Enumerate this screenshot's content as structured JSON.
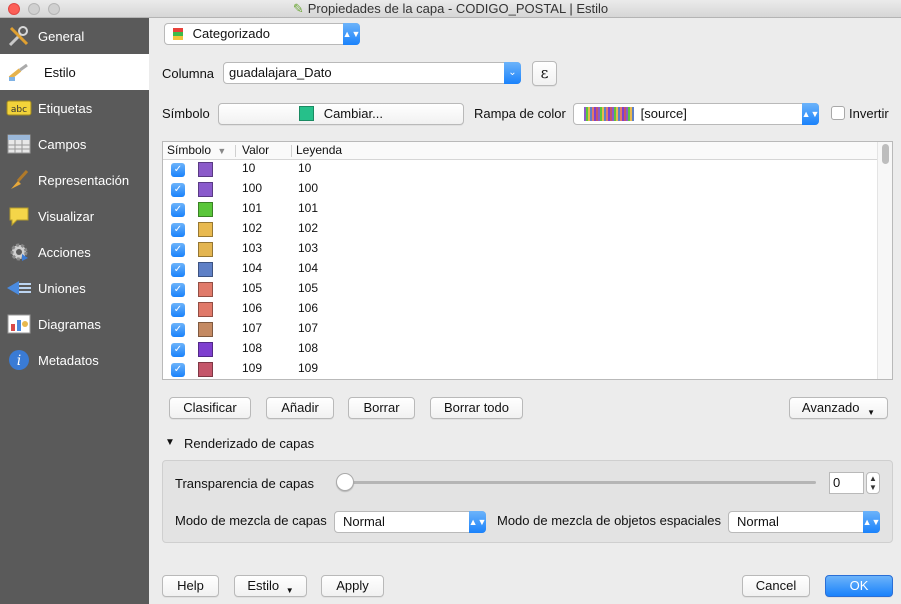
{
  "window": {
    "title": "Propiedades de la capa - CODIGO_POSTAL | Estilo"
  },
  "sidebar": {
    "items": [
      {
        "label": "General",
        "icon": "tools-icon",
        "active": false
      },
      {
        "label": "Estilo",
        "icon": "paintbrush-icon",
        "active": true
      },
      {
        "label": "Etiquetas",
        "icon": "abc-label-icon",
        "active": false
      },
      {
        "label": "Campos",
        "icon": "table-icon",
        "active": false
      },
      {
        "label": "Representación",
        "icon": "broom-icon",
        "active": false
      },
      {
        "label": "Visualizar",
        "icon": "speech-bubble-icon",
        "active": false
      },
      {
        "label": "Acciones",
        "icon": "gear-icon",
        "active": false
      },
      {
        "label": "Uniones",
        "icon": "join-icon",
        "active": false
      },
      {
        "label": "Diagramas",
        "icon": "chart-icon",
        "active": false
      },
      {
        "label": "Metadatos",
        "icon": "info-icon",
        "active": false
      }
    ]
  },
  "renderer": {
    "selected": "Categorizado"
  },
  "column": {
    "label": "Columna",
    "value": "guadalajara_Dato",
    "expression_glyph": "ε"
  },
  "symbol": {
    "label": "Símbolo",
    "change_label": "Cambiar...",
    "color": "#26c08a"
  },
  "ramp": {
    "label": "Rampa de color",
    "value": "[source]",
    "invert_label": "Invertir"
  },
  "table": {
    "headers": [
      "Símbolo",
      "Valor",
      "Leyenda"
    ],
    "rows": [
      {
        "value": "10",
        "legend": "10",
        "color": "#8b5bc9"
      },
      {
        "value": "100",
        "legend": "100",
        "color": "#8a5bcc"
      },
      {
        "value": "101",
        "legend": "101",
        "color": "#5ac63a"
      },
      {
        "value": "102",
        "legend": "102",
        "color": "#e8b94f"
      },
      {
        "value": "103",
        "legend": "103",
        "color": "#e3b551"
      },
      {
        "value": "104",
        "legend": "104",
        "color": "#5f80c6"
      },
      {
        "value": "105",
        "legend": "105",
        "color": "#e07a6a"
      },
      {
        "value": "106",
        "legend": "106",
        "color": "#e07969"
      },
      {
        "value": "107",
        "legend": "107",
        "color": "#c48a63"
      },
      {
        "value": "108",
        "legend": "108",
        "color": "#7e3fcf"
      },
      {
        "value": "109",
        "legend": "109",
        "color": "#c4566a"
      }
    ]
  },
  "actions": {
    "classify": "Clasificar",
    "add": "Añadir",
    "delete": "Borrar",
    "delete_all": "Borrar todo",
    "advanced": "Avanzado"
  },
  "layer_rendering": {
    "title": "Renderizado de capas",
    "transparency_label": "Transparencia de capas",
    "transparency_value": "0",
    "transparency_fraction": 0,
    "layer_blend_label": "Modo de mezcla de capas",
    "layer_blend_value": "Normal",
    "feature_blend_label": "Modo de mezcla de objetos espaciales",
    "feature_blend_value": "Normal"
  },
  "footer": {
    "help": "Help",
    "style": "Estilo",
    "apply": "Apply",
    "cancel": "Cancel",
    "ok": "OK"
  }
}
